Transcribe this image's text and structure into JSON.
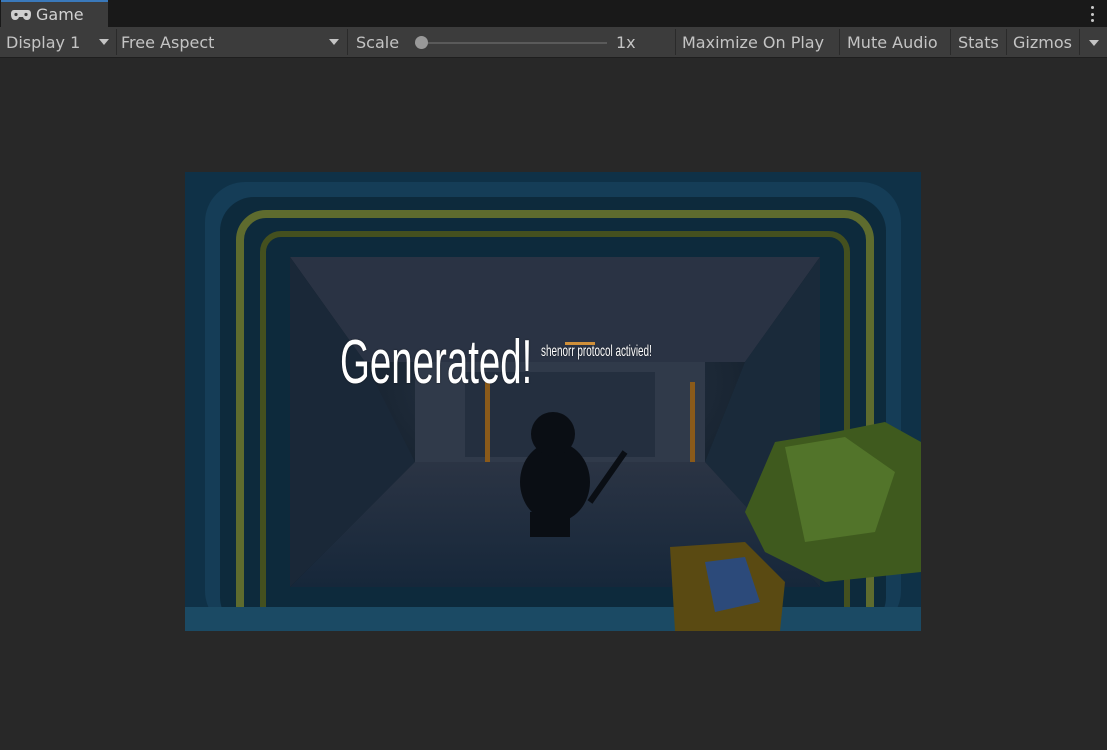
{
  "tab": {
    "title": "Game",
    "icon": "gamepad-icon"
  },
  "toolbar": {
    "display_label": "Display 1",
    "aspect_label": "Free Aspect",
    "scale_label": "Scale",
    "scale_value": "1x",
    "maximize_label": "Maximize On Play",
    "mute_label": "Mute Audio",
    "stats_label": "Stats",
    "gizmos_label": "Gizmos"
  },
  "game_overlay": {
    "generated_text": "Generated!",
    "protocol_text": "shenorr protocol activied!"
  },
  "colors": {
    "tab_accent": "#3a79bb",
    "panel": "#3c3c3c",
    "background": "#282828"
  }
}
